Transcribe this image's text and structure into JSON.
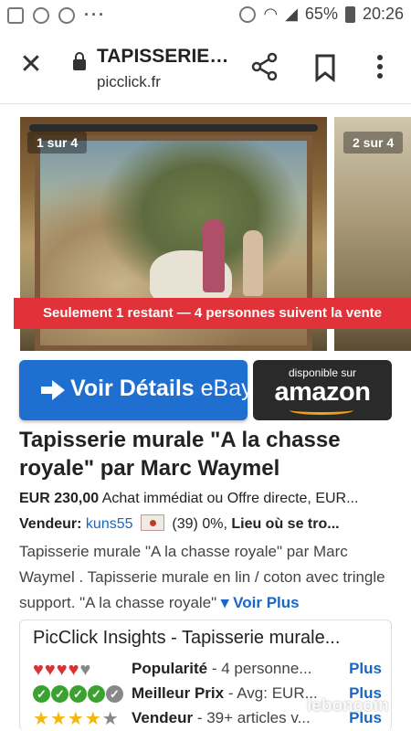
{
  "status_bar": {
    "battery": "65%",
    "time": "20:26",
    "dots": "···"
  },
  "browser": {
    "tab_title": "TAPISSERIE MURALE...",
    "url": "picclick.fr"
  },
  "gallery": {
    "counter_1": "1 sur 4",
    "counter_2": "2 sur 4",
    "banner": "Seulement 1 restant — 4 personnes suivent la vente"
  },
  "buttons": {
    "ebay_prefix": "Voir Détails ",
    "ebay_suffix": "eBay",
    "amazon_small": "disponible sur",
    "amazon_big": "amazon"
  },
  "product": {
    "title": "Tapisserie murale \"A la chasse royale\" par Marc Waymel",
    "price": "EUR 230,00",
    "price_note": "Achat immédiat ou Offre directe, EUR...",
    "seller_label": "Vendeur:",
    "seller_name": "kuns55",
    "seller_stats": "(39) 0%,",
    "location_label": "Lieu où se tro...",
    "description": "Tapisserie murale \"A la chasse royale\" par Marc Waymel . Tapisserie murale en lin / coton avec tringle support. \"A la chasse royale\"",
    "voir_plus": "▾ Voir Plus"
  },
  "insights": {
    "title": "PicClick Insights - Tapisserie murale...",
    "rows": [
      {
        "label": "Popularité",
        "detail": " - 4 personne...",
        "plus": "Plus",
        "score": 4
      },
      {
        "label": "Meilleur Prix",
        "detail": " - Avg: EUR...",
        "plus": "Plus",
        "score": 4
      },
      {
        "label": "Vendeur",
        "detail": " - 39+ articles v...",
        "plus": "Plus",
        "score": 4
      }
    ]
  },
  "watermark": "leboncoin",
  "colors": {
    "link": "#1a66c8",
    "ebay_button": "#1f6fd1",
    "banner": "#e03238",
    "amazon_orange": "#f4a11a"
  }
}
